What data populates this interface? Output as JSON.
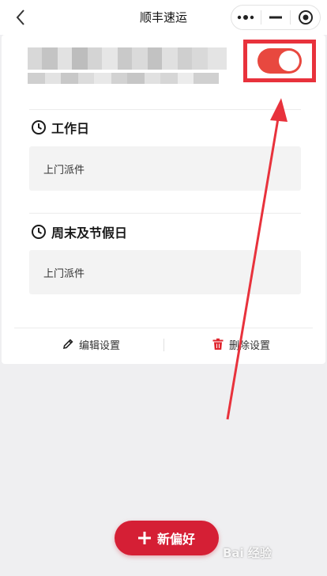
{
  "navbar": {
    "title": "顺丰速运",
    "back_icon": "chevron-left-icon",
    "more_icon": "more-dots-icon",
    "minimize_icon": "minimize-icon",
    "close_icon": "target-circle-icon"
  },
  "card": {
    "toggle_on": true,
    "sections": [
      {
        "icon": "clock-icon",
        "title": "工作日",
        "item": "上门派件"
      },
      {
        "icon": "clock-icon",
        "title": "周末及节假日",
        "item": "上门派件"
      }
    ],
    "actions": {
      "edit_label": "编辑设置",
      "edit_icon": "pencil-icon",
      "delete_label": "删除设置",
      "delete_icon": "trash-icon"
    }
  },
  "fab": {
    "label": "新偏好",
    "icon": "plus-icon"
  },
  "watermark": {
    "text": "Bai 经验"
  },
  "colors": {
    "accent": "#d51f35",
    "toggle": "#e8483f",
    "annotation": "#e8323c",
    "background": "#efeff1"
  }
}
